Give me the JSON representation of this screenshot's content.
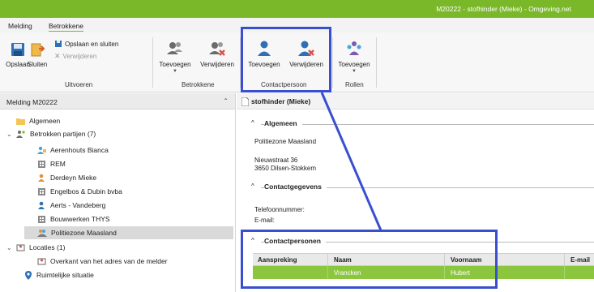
{
  "window": {
    "title": "M20222 - stofhinder (Mieke) - Omgeving.net"
  },
  "ribbon": {
    "tabs": [
      {
        "label": "Melding"
      },
      {
        "label": "Betrokkene"
      }
    ],
    "uitvoeren": {
      "label": "Uitvoeren",
      "save": "Opslaan",
      "close": "Sluiten",
      "save_close": "Opslaan en sluiten",
      "delete": "Verwijderen"
    },
    "betrokkene": {
      "label": "Betrokkene",
      "add": "Toevoegen",
      "remove": "Verwijderen"
    },
    "contactpersoon": {
      "label": "Contactpersoon",
      "add": "Toevoegen",
      "remove": "Verwijderen"
    },
    "rollen": {
      "label": "Rollen",
      "add": "Toevoegen"
    }
  },
  "sidebar": {
    "title": "Melding M20222",
    "items": [
      {
        "label": "Algemeen",
        "icon": "folder-icon"
      },
      {
        "label": "Betrokken partijen (7)",
        "icon": "people-icon"
      },
      {
        "label": "Aerenhouts Bianca",
        "icon": "contact-card-icon"
      },
      {
        "label": "REM",
        "icon": "building-icon"
      },
      {
        "label": "Derdeyn Mieke",
        "icon": "person-icon"
      },
      {
        "label": "Engelbos & Dubin bvba",
        "icon": "building-icon"
      },
      {
        "label": "Aerts - Vandeberg",
        "icon": "person-icon"
      },
      {
        "label": "Bouwwerken THYS",
        "icon": "building-icon"
      },
      {
        "label": "Politiezone Maasland",
        "icon": "handshake-icon"
      },
      {
        "label": "Locaties (1)",
        "icon": "location-icon"
      },
      {
        "label": "Overkant van het adres van de melder",
        "icon": "location-icon"
      },
      {
        "label": "Ruimtelijke situatie",
        "icon": "map-pin-icon"
      }
    ]
  },
  "main": {
    "header": "stofhinder (Mieke)",
    "algemeen": {
      "title": "Algemeen",
      "name": "Politiezone Maasland",
      "street": "Nieuwstraat 36",
      "city": "3650 Dilsen-Stokkem"
    },
    "contactgegevens": {
      "title": "Contactgegevens",
      "phone_label": "Telefoonnummer:",
      "email_label": "E-mail:"
    },
    "contactpersonen": {
      "title": "Contactpersonen",
      "columns": [
        "Aanspreking",
        "Naam",
        "Voornaam",
        "E-mail"
      ],
      "rows": [
        {
          "aanspreking": "",
          "naam": "Vrancken",
          "voornaam": "Hubert",
          "email": ""
        }
      ]
    }
  },
  "colors": {
    "titlebar": "#7ab829",
    "selected_row": "#8cc63f",
    "highlight": "#3a4fd0"
  }
}
